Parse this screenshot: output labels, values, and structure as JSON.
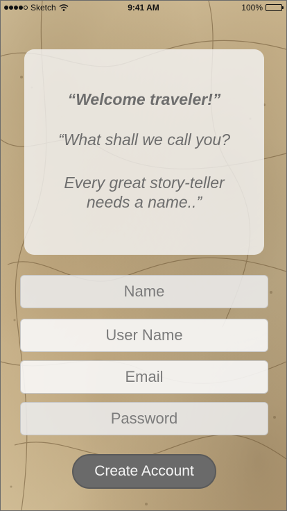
{
  "status_bar": {
    "carrier": "Sketch",
    "time": "9:41 AM",
    "battery_percent": "100%",
    "battery_level": 1.0,
    "signal_bars_filled": 4,
    "signal_bars_total": 5,
    "icons": [
      "signal-icon",
      "wifi-icon",
      "battery-icon"
    ]
  },
  "welcome": {
    "title": "“Welcome traveler!”",
    "question": "“What shall we call you?",
    "line2": "Every great story-teller",
    "line3": "needs a name..”"
  },
  "form": {
    "name_placeholder": "Name",
    "username_placeholder": "User Name",
    "email_placeholder": "Email",
    "password_placeholder": "Password",
    "create_label": "Create Account"
  },
  "colors": {
    "card_text": "#6d6d6d",
    "button_bg": "#6a6a6a",
    "button_text": "#f4f4f4",
    "parchment": "#d7c49e"
  }
}
